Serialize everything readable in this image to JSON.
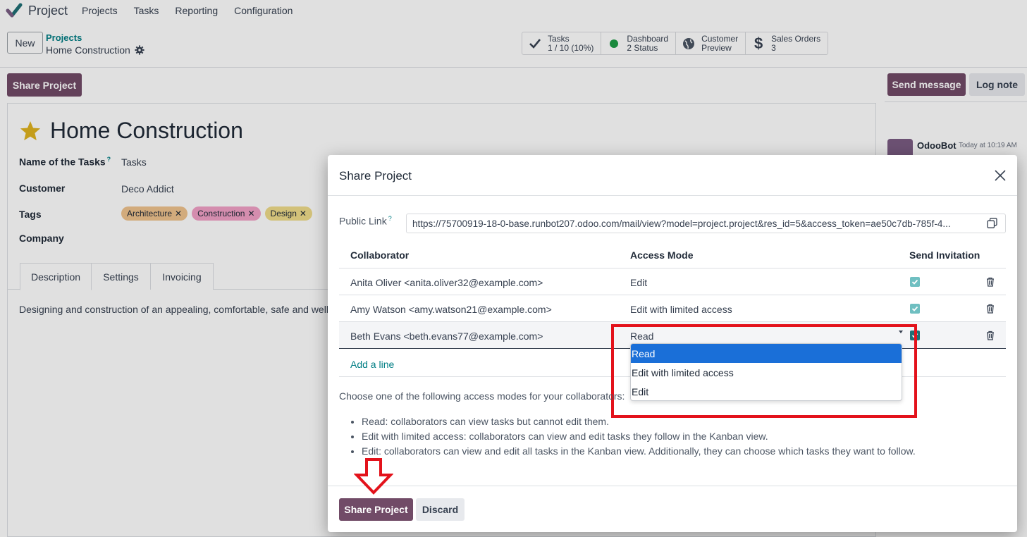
{
  "navbar": {
    "app_name": "Project",
    "menu": [
      "Projects",
      "Tasks",
      "Reporting",
      "Configuration"
    ]
  },
  "control": {
    "new_label": "New",
    "breadcrumb_parent": "Projects",
    "breadcrumb_current": "Home Construction",
    "smart_buttons": [
      {
        "icon": "check-icon",
        "line1": "Tasks",
        "line2": "1 / 10 (10%)"
      },
      {
        "icon": "status-dot-icon",
        "line1": "Dashboard",
        "line2": "2 Status"
      },
      {
        "icon": "globe-icon",
        "line1": "Customer",
        "line2": "Preview"
      },
      {
        "icon": "dollar-icon",
        "line1": "Sales Orders",
        "line2": "3"
      }
    ]
  },
  "form": {
    "share_button": "Share Project",
    "title": "Home Construction",
    "fields": {
      "tasks_label": "Name of the Tasks",
      "tasks_help": "?",
      "tasks_value": "Tasks",
      "customer_label": "Customer",
      "customer_value": "Deco Addict",
      "tags_label": "Tags",
      "company_label": "Company"
    },
    "tags": [
      {
        "label": "Architecture",
        "color": "#f0c38e"
      },
      {
        "label": "Construction",
        "color": "#f2a1c6"
      },
      {
        "label": "Design",
        "color": "#efdc8a"
      }
    ],
    "tabs": [
      "Description",
      "Settings",
      "Invoicing"
    ],
    "description": "Designing and construction of an appealing, comfortable, safe and well"
  },
  "chatter": {
    "send_message": "Send message",
    "log_note": "Log note",
    "author": "OdooBot",
    "time": "Today at 10:19 AM"
  },
  "modal": {
    "title": "Share Project",
    "public_link_label": "Public Link",
    "public_link_help": "?",
    "public_link": "https://75700919-18-0-base.runbot207.odoo.com/mail/view?model=project.project&res_id=5&access_token=ae50c7db-785f-4...",
    "columns": {
      "collaborator": "Collaborator",
      "access_mode": "Access Mode",
      "send_invitation": "Send Invitation"
    },
    "rows": [
      {
        "collaborator": "Anita Oliver <anita.oliver32@example.com>",
        "access": "Edit",
        "invite": true
      },
      {
        "collaborator": "Amy Watson <amy.watson21@example.com>",
        "access": "Edit with limited access",
        "invite": true
      },
      {
        "collaborator": "Beth Evans <beth.evans77@example.com>",
        "access": "Read",
        "invite": true
      }
    ],
    "add_line": "Add a line",
    "dropdown_options": [
      "Read",
      "Edit with limited access",
      "Edit"
    ],
    "help_intro": "Choose one of the following access modes for your collaborators:",
    "help_items": [
      "Read: collaborators can view tasks but cannot edit them.",
      "Edit with limited access: collaborators can view and edit tasks they follow in the Kanban view.",
      "Edit: collaborators can view and edit all tasks in the Kanban view. Additionally, they can choose which tasks they want to follow."
    ],
    "share_button": "Share Project",
    "discard_button": "Discard"
  },
  "colors": {
    "primary": "#714b67",
    "link": "#017e84",
    "highlight": "#e3121b",
    "selection": "#1a6fd8"
  }
}
